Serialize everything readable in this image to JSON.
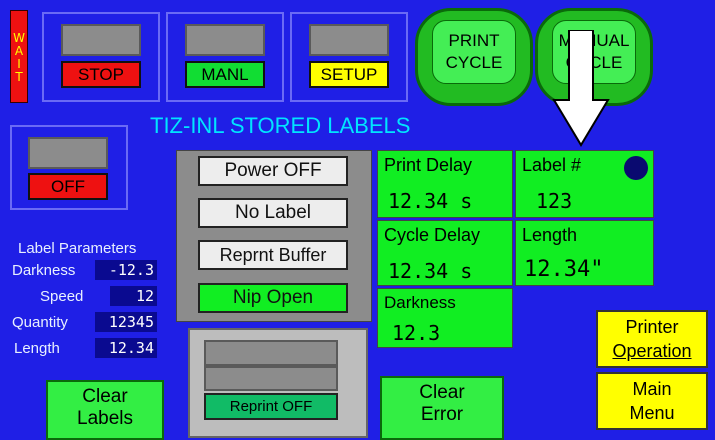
{
  "status_bar": {
    "wait_text": "WAIT"
  },
  "top_buttons": {
    "stop": "STOP",
    "manl": "MANL",
    "setup": "SETUP"
  },
  "cycle_buttons": {
    "print_line1": "PRINT",
    "print_line2": "CYCLE",
    "manual_line1": "MANUAL",
    "manual_line2": "CYCLE"
  },
  "off_button": "OFF",
  "page_title": "TIZ-INL STORED LABELS",
  "label_parameters": {
    "heading": "Label Parameters",
    "rows": [
      {
        "label": "Darkness",
        "value": "-12.3"
      },
      {
        "label": "Speed",
        "value": "12"
      },
      {
        "label": "Quantity",
        "value": "12345"
      },
      {
        "label": "Length",
        "value": "12.34"
      }
    ]
  },
  "indicators": {
    "power": "Power OFF",
    "no_label": "No Label",
    "reprint_buffer": "Reprnt Buffer",
    "nip": "Nip Open"
  },
  "reprint_panel": {
    "status": "Reprint OFF"
  },
  "tiles": {
    "print_delay": {
      "label": "Print Delay",
      "value": "12.34 s"
    },
    "label_no": {
      "label": "Label #",
      "value": "123"
    },
    "cycle_delay": {
      "label": "Cycle Delay",
      "value": "12.34 s"
    },
    "length": {
      "label": "Length",
      "value": "12.34\""
    },
    "darkness": {
      "label": "Darkness",
      "value": "12.3"
    }
  },
  "bottom_buttons": {
    "clear_labels_l1": "Clear",
    "clear_labels_l2": "Labels",
    "clear_error_l1": "Clear",
    "clear_error_l2": "Error",
    "printer_op_l1": "Printer",
    "printer_op_l2": "Operation",
    "main_menu_l1": "Main",
    "main_menu_l2": "Menu"
  },
  "colors": {
    "background": "#1f1fe6",
    "tile_green": "#11ee22",
    "stop_red": "#ee1111",
    "setup_yellow": "#ffff00",
    "indicator_dot": "#0a0a70"
  },
  "icons": {
    "arrow": "down-arrow-icon",
    "dot": "status-dot-icon"
  }
}
